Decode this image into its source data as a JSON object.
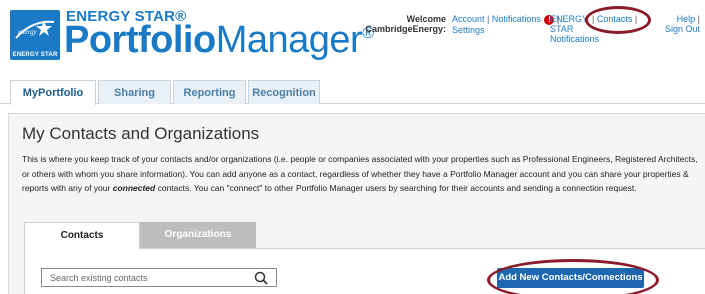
{
  "brand": {
    "logo_text": "ENERGY STAR",
    "energy_star_label": "ENERGY STAR®",
    "product_bold": "Portfolio",
    "product_light": "Manager",
    "reg_mark": "®"
  },
  "user": {
    "welcome": "Welcome",
    "account_name": "CambridgeEnergy:"
  },
  "toplinks": {
    "account": "Account",
    "settings": "Settings",
    "notifications": "Notifications",
    "notification_badge": "!",
    "energy_star_notifications": "ENERGY STAR Notifications",
    "contacts": "Contacts",
    "help": "Help",
    "sign_out": "Sign Out",
    "separator": "|"
  },
  "nav": {
    "tabs": [
      {
        "label": "MyPortfolio"
      },
      {
        "label": "Sharing"
      },
      {
        "label": "Reporting"
      },
      {
        "label": "Recognition"
      }
    ]
  },
  "page": {
    "title": "My Contacts and Organizations",
    "intro_part1": "This is where you keep track of your contacts and/or organizations (i.e. people or companies associated with your properties such as Professional Engineers, Registered Architects, or others with whom you share information). You can add anyone as a contact, regardless of whether they have a Portfolio Manager account and you can share your properties & reports with any of your ",
    "intro_em": "connected",
    "intro_part2": " contacts. You can \"connect\" to other Portfolio Manager users by searching for their accounts and sending a connection request."
  },
  "subtabs": [
    {
      "label": "Contacts"
    },
    {
      "label": "Organizations"
    }
  ],
  "search": {
    "placeholder": "Search existing contacts",
    "value": ""
  },
  "actions": {
    "add_contacts_label": "Add New Contacts/Connections"
  },
  "colors": {
    "brand_blue": "#1a7ac6",
    "button_blue": "#1d67b0",
    "annotation_maroon": "#8b1a2a",
    "alert_red": "#cc0000"
  },
  "icons": {
    "logo": "energy-star-logo-icon",
    "notification": "alert-badge-icon",
    "search": "magnifier-icon"
  }
}
